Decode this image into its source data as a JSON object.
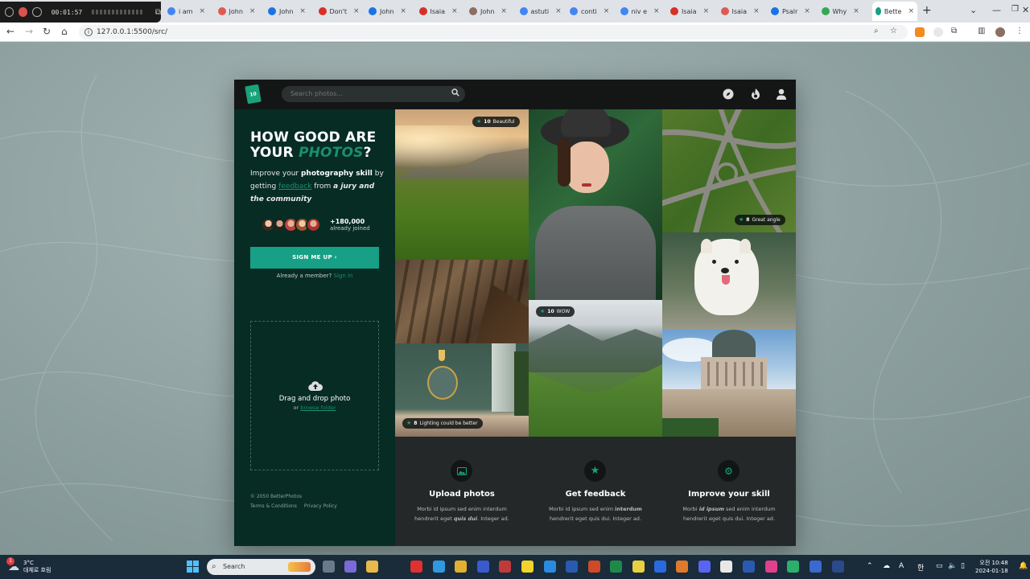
{
  "recorder": {
    "time": "00:01:57"
  },
  "browser": {
    "tabs": [
      {
        "label": "i am",
        "color": "#4285f4"
      },
      {
        "label": "John",
        "color": "#e05a4f"
      },
      {
        "label": "John",
        "color": "#1a73e8"
      },
      {
        "label": "Don't",
        "color": "#d93025"
      },
      {
        "label": "John",
        "color": "#1a73e8"
      },
      {
        "label": "Isaia",
        "color": "#d93025"
      },
      {
        "label": "John",
        "color": "#8d6e63"
      },
      {
        "label": "astuti",
        "color": "#4285f4"
      },
      {
        "label": "conti",
        "color": "#4285f4"
      },
      {
        "label": "niv e",
        "color": "#4285f4"
      },
      {
        "label": "Isaia",
        "color": "#d93025"
      },
      {
        "label": "Isaia",
        "color": "#e05a4f"
      },
      {
        "label": "Psalr",
        "color": "#1a73e8"
      },
      {
        "label": "Why",
        "color": "#34a853"
      }
    ],
    "active_tab": "Bette",
    "url": "127.0.0.1:5500/src/"
  },
  "app": {
    "logo_text": "10",
    "search_placeholder": "Search photos...",
    "hero": {
      "title_line1": "HOW GOOD ARE",
      "title_line2_a": "YOUR ",
      "title_line2_accent": "PHOTOS",
      "title_line2_b": "?",
      "sub_1": "Improve your ",
      "sub_bold": "photography skill",
      "sub_2": " by getting ",
      "sub_link": "feedback",
      "sub_3": " from ",
      "sub_italic": "a jury and the community"
    },
    "joined_count": "+180,000",
    "joined_label": "already joined",
    "signup_label": "SIGN ME UP ›",
    "member_text": "Already a member? ",
    "member_link": "Sign in",
    "dropzone": {
      "title": "Drag and drop photo",
      "or": "or ",
      "link": "browse folder"
    },
    "footer": {
      "copyright": "© 2050 BetterPhotos",
      "terms": "Terms & Conditions",
      "privacy": "Privacy Policy"
    },
    "photos": [
      {
        "score": "10",
        "caption": "Beautiful"
      },
      {
        "score": "8",
        "caption": "Great angle"
      },
      {
        "score": "10",
        "caption": "WOW"
      },
      {
        "score": "8",
        "caption": "Lighting could be better"
      }
    ],
    "features": [
      {
        "title": "Upload photos",
        "text_1": "Morbi id ipsum sed enim interdum hendrerit eget ",
        "text_em": "quis dui",
        "text_2": ". Integer ad."
      },
      {
        "title": "Get feedback",
        "text_1": "Morbi id ipsum sed enim ",
        "text_em": "interdum",
        "text_2": " hendrerit eget quis dui. Integer ad."
      },
      {
        "title": "Improve your skill",
        "text_1": "Morbi ",
        "text_em": "id ipsum",
        "text_2": " sed enim interdum hendrerit eget quis dui. Integer ad."
      }
    ]
  },
  "taskbar": {
    "temp": "3°C",
    "weather": "대체로 흐림",
    "search": "Search",
    "ime": "A",
    "lang": "한",
    "time": "오전 10:48",
    "date": "2024-01-18",
    "notif": "1"
  }
}
